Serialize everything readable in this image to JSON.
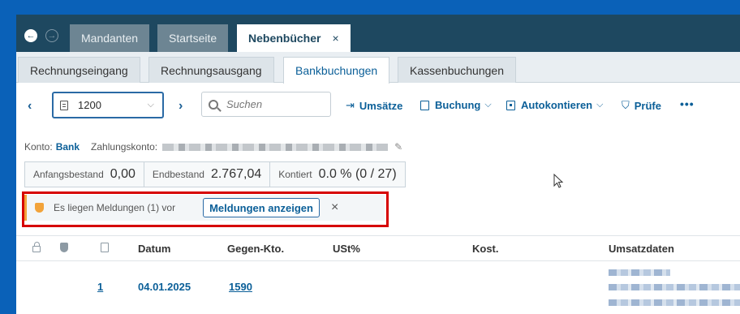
{
  "top_tabs": [
    {
      "label": "Mandanten"
    },
    {
      "label": "Startseite"
    },
    {
      "label": "Nebenbücher",
      "close": "×"
    }
  ],
  "sub_tabs": [
    {
      "label": "Rechnungseingang"
    },
    {
      "label": "Rechnungsausgang"
    },
    {
      "label": "Bankbuchungen"
    },
    {
      "label": "Kassenbuchungen"
    }
  ],
  "toolbar": {
    "prev": "‹",
    "next": "›",
    "account_value": "1200",
    "search_placeholder": "Suchen",
    "umsaetze": "Umsätze",
    "buchung": "Buchung",
    "autokontieren": "Autokontieren",
    "pruefe": "Prüfe",
    "more": "•••"
  },
  "konto": {
    "label": "Konto:",
    "value": "Bank",
    "zahlungskonto_label": "Zahlungskonto:"
  },
  "balances": {
    "anfangsbestand_label": "Anfangsbestand",
    "anfangsbestand_value": "0,00",
    "endbestand_label": "Endbestand",
    "endbestand_value": "2.767,04",
    "kontiert_label": "Kontiert",
    "kontiert_value": "0.0 % (0 / 27)"
  },
  "message": {
    "text": "Es liegen Meldungen (1) vor",
    "button": "Meldungen anzeigen",
    "close": "×"
  },
  "table": {
    "columns": [
      "Datum",
      "Gegen-Kto.",
      "USt%",
      "Kost.",
      "Umsatzdaten"
    ],
    "rows": [
      {
        "nr": "1",
        "datum": "04.01.2025",
        "gegenkonto": "1590"
      }
    ]
  },
  "colors": {
    "frame": "#0a61b8",
    "topbar": "#1e4860",
    "accent": "#0b5f98",
    "warning": "#f2a33a",
    "highlight": "#d60000"
  }
}
